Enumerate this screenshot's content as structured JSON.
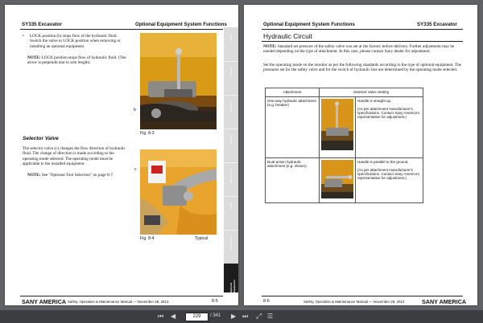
{
  "left_page": {
    "header_left": "SY335 Excavator",
    "header_right": "Optional Equipment System Functions",
    "bullet_text": "LOCK position (b) stops flow of the hydraulic fluid. Switch the valve to LOCK position when removing or installing an optional equipment.",
    "note_label": "NOTE:",
    "note_text": "LOCK position stops flow of hydraulic fluid. (The arrow is perpendicular to arm length).",
    "fig1_caption": "Fig. 8-3",
    "fig1_callout": "b",
    "section_title": "Selector Valve",
    "section_text": "The selector valve (c) changes the flow direction of hydraulic fluid. The change of direction is made according to the operating mode selected. The operating mode must be applicable to the installed equipment.",
    "note2_label": "NOTE:",
    "note2_text": "See \"Optional Tool Selection\" on page 8-7.",
    "fig2_callout": "c",
    "fig2_caption": "Fig. 8-4",
    "fig2_typical": "Typical",
    "tabs": [
      {
        "label": "Safety"
      },
      {
        "label": "Controls"
      },
      {
        "label": "Operation"
      },
      {
        "label": "Transport"
      },
      {
        "label": "Maintenance"
      },
      {
        "label": "Specs"
      },
      {
        "label": "Troubleshoot"
      },
      {
        "label": "Optional Equipment"
      }
    ],
    "footer_brand": "SANY AMERICA",
    "footer_title": "Safety, Operation & Maintenance Manual — November 28, 2013",
    "footer_page": "8-5"
  },
  "right_page": {
    "header_left": "Optional Equipment System Functions",
    "header_right": "SY335 Excavator",
    "title": "Hydraulic Circuit",
    "note_label": "NOTE:",
    "note_text": "Standard set pressure of the safety valve was set at the factory before delivery. Further adjustment may be needed depending on the type of attachment. In this case, please contact Sany dealer for adjustment.",
    "para": "Set the operating mode on the monitor as per the following standards according to the type of optional equipment. The pressures set for the safety valve and for the switch of hydraulic line are determined by the operating mode selected.",
    "table": {
      "col1": "Attachment",
      "col2": "Selector Valve Setting",
      "rows": [
        {
          "attachment": "One-way hydraulic attachment (e.g. breaker)",
          "setting_main": "Handle is straight up.",
          "setting_sub": "(As per attachment manufacturer's specifications. Contact Sany America's representative for adjustment.)"
        },
        {
          "attachment": "Dual-action hydraulic attachment (e.g. shears)",
          "setting_main": "Handle is parallel to the ground.",
          "setting_sub": "(As per attachment manufacturer's specifications. Contact Sany America's representative for adjustment.)"
        }
      ]
    },
    "footer_page": "8-6",
    "footer_title": "Safety, Operation & Maintenance Manual — November 28, 2013",
    "footer_brand": "SANY AMERICA"
  },
  "toolbar": {
    "current_page": "229",
    "total_pages": "/ 341"
  }
}
